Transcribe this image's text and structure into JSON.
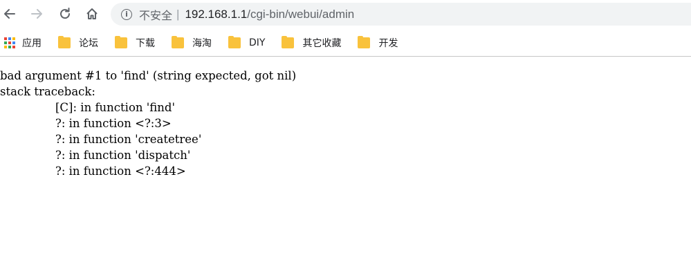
{
  "browser": {
    "security_label": "不安全",
    "separator": "|",
    "url_host": "192.168.1.1",
    "url_path": "/cgi-bin/webui/admin"
  },
  "bookmarks": [
    {
      "label": "应用",
      "icon": "apps-icon"
    },
    {
      "label": "论坛",
      "icon": "folder-icon"
    },
    {
      "label": "下载",
      "icon": "folder-icon"
    },
    {
      "label": "海淘",
      "icon": "folder-icon"
    },
    {
      "label": "DIY",
      "icon": "folder-icon"
    },
    {
      "label": "其它收藏",
      "icon": "folder-icon"
    },
    {
      "label": "开发",
      "icon": "folder-icon"
    }
  ],
  "page": {
    "error_line": "bad argument #1 to 'find' (string expected, got nil)",
    "traceback_header": "stack traceback:",
    "trace_lines": [
      "[C]: in function 'find'",
      "?: in function <?:3>",
      "?: in function 'createtree'",
      "?: in function 'dispatch'",
      "?: in function <?:444>"
    ]
  },
  "colors": {
    "folder": "#f9c23c",
    "omnibox_bg": "#f1f3f4",
    "apps_grid": [
      "#ea4335",
      "#4285f4",
      "#fbbc05",
      "#34a853",
      "#ea4335",
      "#4285f4",
      "#fbbc05",
      "#34a853",
      "#ea4335"
    ]
  }
}
